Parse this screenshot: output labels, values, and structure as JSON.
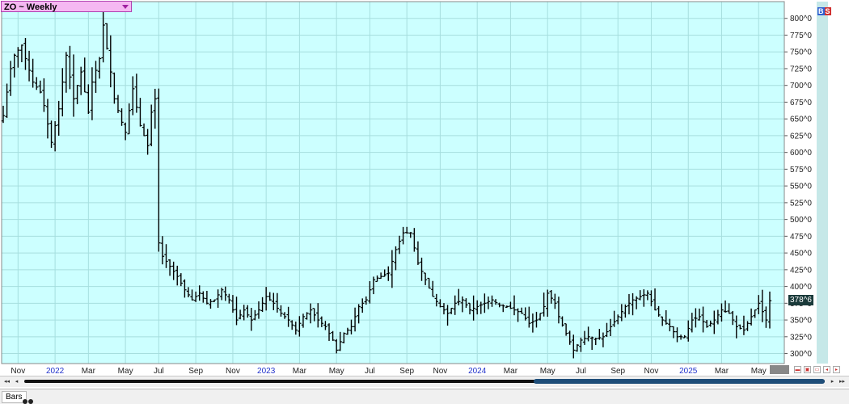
{
  "header": {
    "symbol_label": "ZO ~ Weekly",
    "bs_b": "B",
    "bs_s": "S"
  },
  "price_label": "378^6",
  "bottom": {
    "tab_label": "Bars"
  },
  "nav": {
    "first": "◂◂",
    "prev": "◂",
    "next": "▸",
    "last": "▸▸"
  },
  "colors": {
    "plot_bg": "#ccffff",
    "grid": "#a6dede",
    "bar": "#000000",
    "axis_line": "#ff5050",
    "scrollbar": "#1f4e79"
  },
  "chart_data": {
    "type": "bar",
    "style": "ohlc-weekly",
    "ylim": [
      285,
      825
    ],
    "y_ticks": [
      300,
      325,
      350,
      375,
      400,
      425,
      450,
      475,
      500,
      525,
      550,
      575,
      600,
      625,
      650,
      675,
      700,
      725,
      750,
      775,
      800
    ],
    "y_tick_labels": [
      "300^0",
      "325^0",
      "350^0",
      "375^0",
      "400^0",
      "425^0",
      "450^0",
      "475^0",
      "500^0",
      "525^0",
      "550^0",
      "575^0",
      "600^0",
      "625^0",
      "650^0",
      "675^0",
      "700^0",
      "725^0",
      "750^0",
      "775^0",
      "800^0"
    ],
    "x_labels": [
      {
        "label": "Nov",
        "week": 4,
        "year": false
      },
      {
        "label": "2022",
        "week": 14,
        "year": true
      },
      {
        "label": "Mar",
        "week": 23,
        "year": false
      },
      {
        "label": "May",
        "week": 33,
        "year": false
      },
      {
        "label": "Jul",
        "week": 42,
        "year": false
      },
      {
        "label": "Sep",
        "week": 52,
        "year": false
      },
      {
        "label": "Nov",
        "week": 62,
        "year": false
      },
      {
        "label": "2023",
        "week": 71,
        "year": true
      },
      {
        "label": "Mar",
        "week": 80,
        "year": false
      },
      {
        "label": "May",
        "week": 90,
        "year": false
      },
      {
        "label": "Jul",
        "week": 99,
        "year": false
      },
      {
        "label": "Sep",
        "week": 109,
        "year": false
      },
      {
        "label": "Nov",
        "week": 118,
        "year": false
      },
      {
        "label": "2024",
        "week": 128,
        "year": true
      },
      {
        "label": "Mar",
        "week": 137,
        "year": false
      },
      {
        "label": "May",
        "week": 147,
        "year": false
      },
      {
        "label": "Jul",
        "week": 156,
        "year": false
      },
      {
        "label": "Sep",
        "week": 166,
        "year": false
      },
      {
        "label": "Nov",
        "week": 175,
        "year": false
      },
      {
        "label": "2025",
        "week": 185,
        "year": true
      },
      {
        "label": "Mar",
        "week": 194,
        "year": false
      },
      {
        "label": "May",
        "week": 204,
        "year": false
      }
    ],
    "last_price": 378.75,
    "anchors": [
      [
        0,
        655
      ],
      [
        2,
        725
      ],
      [
        3,
        745
      ],
      [
        5,
        760
      ],
      [
        6,
        740
      ],
      [
        8,
        705
      ],
      [
        10,
        690
      ],
      [
        11,
        670
      ],
      [
        13,
        615
      ],
      [
        15,
        665
      ],
      [
        17,
        745
      ],
      [
        19,
        680
      ],
      [
        20,
        700
      ],
      [
        21,
        720
      ],
      [
        23,
        660
      ],
      [
        24,
        705
      ],
      [
        26,
        740
      ],
      [
        27,
        790
      ],
      [
        29,
        720
      ],
      [
        30,
        680
      ],
      [
        32,
        645
      ],
      [
        33,
        630
      ],
      [
        35,
        695
      ],
      [
        37,
        640
      ],
      [
        39,
        610
      ],
      [
        40,
        660
      ],
      [
        41,
        680
      ],
      [
        42,
        465
      ],
      [
        43,
        445
      ],
      [
        45,
        430
      ],
      [
        47,
        415
      ],
      [
        49,
        395
      ],
      [
        51,
        380
      ],
      [
        53,
        390
      ],
      [
        55,
        375
      ],
      [
        57,
        380
      ],
      [
        59,
        395
      ],
      [
        61,
        380
      ],
      [
        63,
        350
      ],
      [
        65,
        365
      ],
      [
        67,
        350
      ],
      [
        69,
        365
      ],
      [
        71,
        385
      ],
      [
        73,
        375
      ],
      [
        75,
        360
      ],
      [
        77,
        350
      ],
      [
        79,
        335
      ],
      [
        81,
        355
      ],
      [
        83,
        365
      ],
      [
        85,
        350
      ],
      [
        87,
        340
      ],
      [
        89,
        320
      ],
      [
        90,
        305
      ],
      [
        92,
        330
      ],
      [
        94,
        340
      ],
      [
        96,
        370
      ],
      [
        98,
        380
      ],
      [
        100,
        410
      ],
      [
        102,
        415
      ],
      [
        104,
        420
      ],
      [
        106,
        455
      ],
      [
        108,
        480
      ],
      [
        110,
        480
      ],
      [
        112,
        435
      ],
      [
        114,
        410
      ],
      [
        116,
        385
      ],
      [
        118,
        370
      ],
      [
        120,
        360
      ],
      [
        122,
        375
      ],
      [
        124,
        380
      ],
      [
        126,
        365
      ],
      [
        128,
        370
      ],
      [
        130,
        375
      ],
      [
        132,
        380
      ],
      [
        134,
        372
      ],
      [
        136,
        370
      ],
      [
        138,
        365
      ],
      [
        140,
        360
      ],
      [
        142,
        345
      ],
      [
        144,
        350
      ],
      [
        146,
        370
      ],
      [
        147,
        390
      ],
      [
        149,
        375
      ],
      [
        150,
        355
      ],
      [
        152,
        330
      ],
      [
        154,
        305
      ],
      [
        156,
        320
      ],
      [
        158,
        325
      ],
      [
        160,
        322
      ],
      [
        162,
        325
      ],
      [
        164,
        340
      ],
      [
        166,
        355
      ],
      [
        168,
        370
      ],
      [
        170,
        380
      ],
      [
        172,
        385
      ],
      [
        174,
        390
      ],
      [
        176,
        365
      ],
      [
        178,
        350
      ],
      [
        180,
        340
      ],
      [
        182,
        325
      ],
      [
        184,
        325
      ],
      [
        186,
        350
      ],
      [
        188,
        355
      ],
      [
        190,
        340
      ],
      [
        192,
        350
      ],
      [
        194,
        365
      ],
      [
        196,
        360
      ],
      [
        198,
        340
      ],
      [
        200,
        335
      ],
      [
        202,
        355
      ],
      [
        204,
        375
      ],
      [
        206,
        350
      ],
      [
        207,
        378.75
      ]
    ]
  }
}
